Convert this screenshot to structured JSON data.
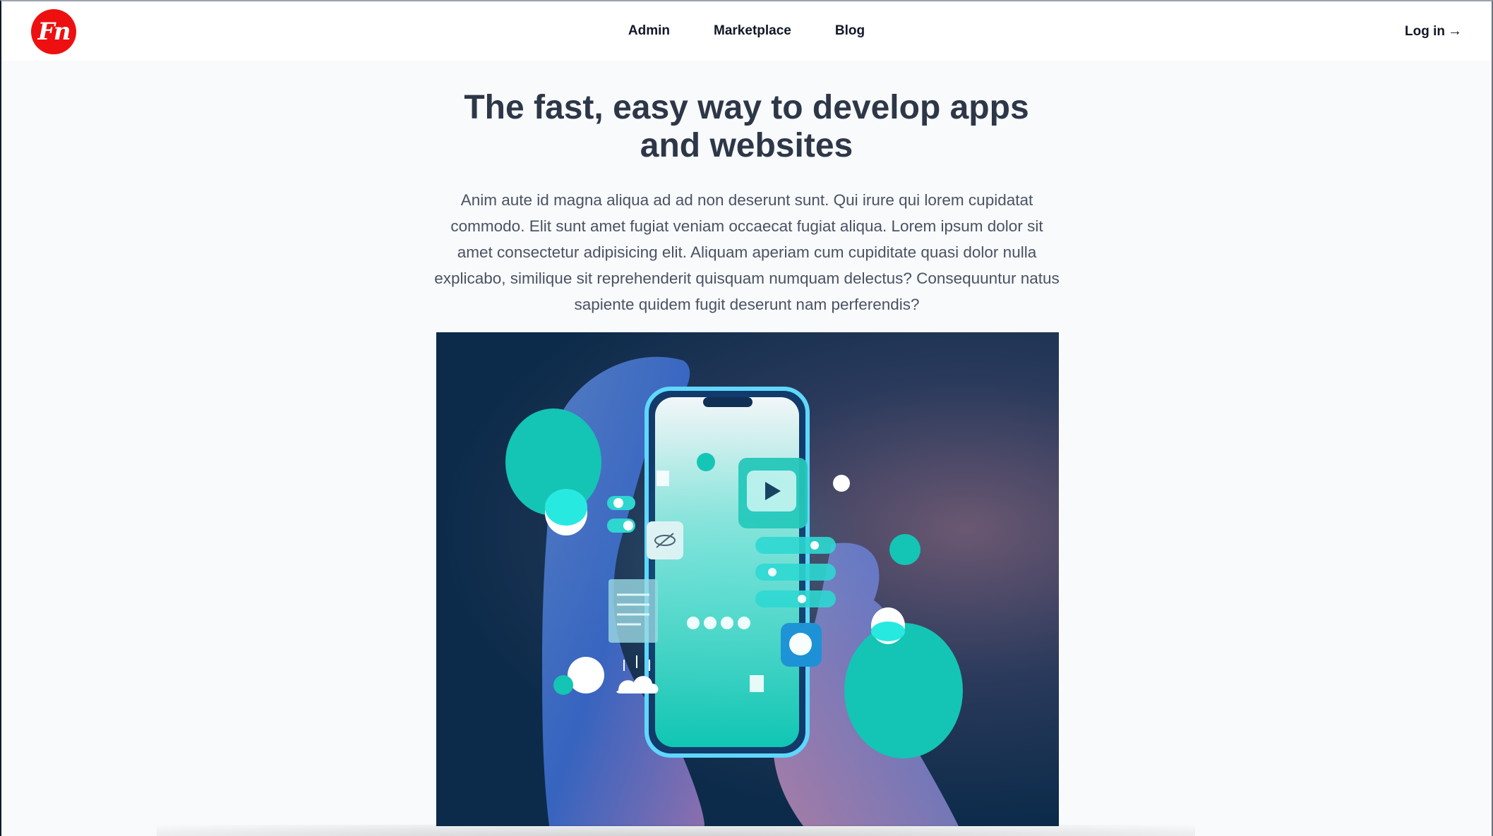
{
  "brand": {
    "logo_text": "Fn",
    "logo_color": "#ee1010"
  },
  "nav": {
    "items": [
      {
        "label": "Admin"
      },
      {
        "label": "Marketplace"
      },
      {
        "label": "Blog"
      }
    ],
    "login_label": "Log in",
    "login_arrow": "→"
  },
  "hero": {
    "title_line1": "The fast, easy way to develop apps",
    "title_line2": "and websites",
    "paragraph": "Anim aute id magna aliqua ad ad non deserunt sunt. Qui irure qui lorem cupidatat commodo. Elit sunt amet fugiat veniam occaecat fugiat aliqua. Lorem ipsum dolor sit amet consectetur adipisicing elit. Aliquam aperiam cum cupiditate quasi dolor nulla explicabo, similique sit reprehenderit quisquam numquam delectus? Consequuntur natus sapiente quidem fugit deserunt nam perferendis?"
  },
  "colors": {
    "accent_teal": "#14c4b4",
    "title_color": "#2d3748",
    "text_color": "#4a5263"
  }
}
